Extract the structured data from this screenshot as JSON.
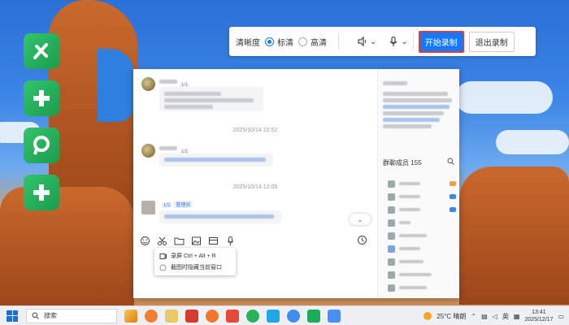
{
  "desktop": {
    "icons": [
      "app-1-icon",
      "app-2-icon",
      "app-3-icon",
      "app-4-icon"
    ]
  },
  "record_toolbar": {
    "clarity_label": "清晰度",
    "options": [
      {
        "label": "标清",
        "selected": true
      },
      {
        "label": "高清",
        "selected": false
      }
    ],
    "speaker_icon": "speaker-icon",
    "mic_icon": "microphone-icon",
    "start_label": "开始录制",
    "exit_label": "退出录制"
  },
  "chat": {
    "messages": [
      {
        "timestamp": ""
      },
      {
        "timestamp": "2025/10/14 10:52"
      },
      {
        "timestamp": "2025/10/14 12:05"
      }
    ],
    "jump_icon": "double-chevron-down-icon",
    "input_toolbar": [
      "smiley-icon",
      "scissors-icon",
      "folder-icon",
      "image-icon",
      "mail-icon",
      "microphone-icon",
      "clock-icon"
    ],
    "screenshot_menu": {
      "items": [
        {
          "label": "录屏 Ctrl + Alt + R"
        },
        {
          "label": "截图时隐藏当前窗口"
        }
      ]
    },
    "sidebar": {
      "members_title": "群聊成员 155"
    }
  },
  "taskbar": {
    "search_label": "搜索",
    "weather": "25°C 晴朗",
    "ime": "英",
    "time": "13:41",
    "date": "2025/12/17"
  },
  "colors": {
    "accent": "#1677ff",
    "start_border": "#e53935"
  }
}
